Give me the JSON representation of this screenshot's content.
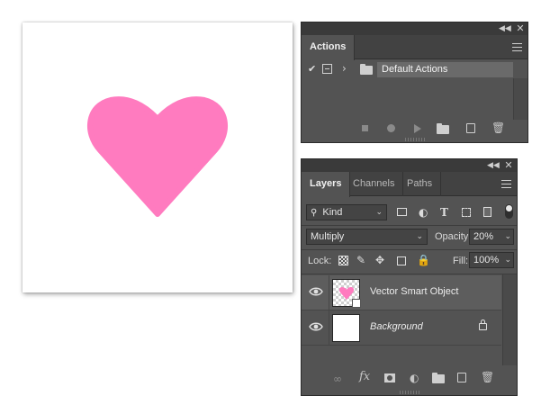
{
  "canvas": {
    "heart_color": "#ff7bbf",
    "background_color": "#ffffff"
  },
  "actions_panel": {
    "tab_label": "Actions",
    "item_label": "Default Actions",
    "icons": [
      "check-icon",
      "dialog-toggle-icon",
      "chevron-right-icon",
      "folder-icon"
    ],
    "bottom_icons": [
      "stop-icon",
      "record-icon",
      "play-icon",
      "new-set-icon",
      "new-action-icon",
      "trash-icon"
    ]
  },
  "layers_panel": {
    "tabs": [
      "Layers",
      "Channels",
      "Paths"
    ],
    "filter_kind": "Kind",
    "blend_mode": "Multiply",
    "opacity_label": "Opacity:",
    "opacity_value": "20%",
    "lock_label": "Lock:",
    "fill_label": "Fill:",
    "fill_value": "100%",
    "layers": [
      {
        "name": "Vector Smart Object",
        "visible": true,
        "type": "smart-object",
        "locked": false
      },
      {
        "name": "Background",
        "visible": true,
        "type": "background",
        "locked": true
      }
    ],
    "bottom_icons": [
      "link-icon",
      "fx-icon",
      "mask-icon",
      "adjustment-icon",
      "group-icon",
      "new-layer-icon",
      "trash-icon"
    ]
  },
  "colors": {
    "panel_bg": "#535353",
    "panel_dark": "#424242",
    "accent_heart": "#ff7bbf"
  }
}
